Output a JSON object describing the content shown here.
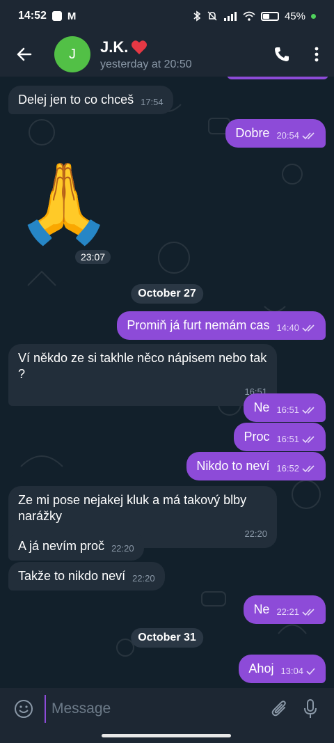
{
  "status_bar": {
    "time": "14:52",
    "battery_percent": "45%",
    "accent_dot_color": "#4fd25c"
  },
  "header": {
    "avatar_letter": "J",
    "avatar_color": "#52c046",
    "contact_name": "J.K.",
    "heart_icon": "heart-icon",
    "last_seen": "yesterday at 20:50"
  },
  "colors": {
    "outgoing_bubble": "#8d4bd8",
    "incoming_bubble": "#222e3a",
    "chat_background": "#12202b"
  },
  "messages": [
    {
      "direction": "in",
      "text": "Delej jen to co chceš",
      "time": "17:54"
    },
    {
      "direction": "out",
      "text": "Dobre",
      "time": "20:54",
      "status": "read"
    },
    {
      "direction": "in",
      "type": "emoji",
      "text": "🙏",
      "time": "23:07"
    },
    {
      "direction": "date",
      "text": "October 27"
    },
    {
      "direction": "out",
      "text": "Promiň já furt nemám cas",
      "time": "14:40",
      "status": "read"
    },
    {
      "direction": "in",
      "text": "Ví někdo ze si takhle něco nápisem nebo tak ?",
      "time": "16:51"
    },
    {
      "direction": "out",
      "text": "Ne",
      "time": "16:51",
      "status": "read"
    },
    {
      "direction": "out",
      "text": "Proc",
      "time": "16:51",
      "status": "read"
    },
    {
      "direction": "out",
      "text": "Nikdo to neví",
      "time": "16:52",
      "status": "read"
    },
    {
      "direction": "in",
      "text": "Ze mi pose nejakej kluk a má takový blby narážky",
      "time": "22:20"
    },
    {
      "direction": "in",
      "text": "A já nevím proč",
      "time": "22:20"
    },
    {
      "direction": "in",
      "text": "Takže to nikdo neví",
      "time": "22:20"
    },
    {
      "direction": "out",
      "text": "Ne",
      "time": "22:21",
      "status": "read"
    },
    {
      "direction": "date",
      "text": "October 31"
    },
    {
      "direction": "out",
      "text": "Ahoj",
      "time": "13:04",
      "status": "sent"
    }
  ],
  "input": {
    "placeholder": "Message"
  }
}
